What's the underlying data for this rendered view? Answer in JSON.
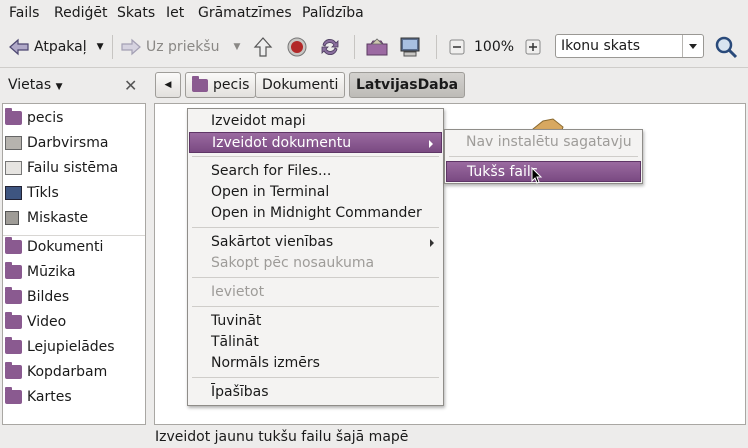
{
  "menubar": {
    "items": [
      "Fails",
      "Rediģēt",
      "Skats",
      "Iet",
      "Grāmatzīmes",
      "Palīdzība"
    ]
  },
  "toolbar": {
    "back_label": "Atpakaļ",
    "forward_label": "Uz priekšu",
    "zoom": "100%",
    "view_mode": "Ikonu skats"
  },
  "sidebar": {
    "title": "Vietas",
    "items": [
      "pecis",
      "Darbvirsma",
      "Failu sistēma",
      "Tīkls",
      "Miskaste",
      "Dokumenti",
      "Mūzika",
      "Bildes",
      "Video",
      "Lejupielādes",
      "Kopdarbam",
      "Kartes"
    ]
  },
  "pathbar": {
    "crumbs": [
      "pecis",
      "Dokumenti",
      "LatvijasDaba"
    ]
  },
  "context_menu": {
    "create_folder": "Izveidot mapi",
    "create_document": "Izveidot dokumentu",
    "search_files": "Search for Files...",
    "open_terminal": "Open in Terminal",
    "open_mc": "Open in Midnight Commander",
    "arrange_items": "Sakārtot vienības",
    "sort_by_name": "Sakopt pēc nosaukuma",
    "paste": "Ievietot",
    "zoom_in": "Tuvināt",
    "zoom_out": "Tālināt",
    "normal_size": "Normāls izmērs",
    "properties": "Īpašības"
  },
  "submenu": {
    "no_templates": "Nav instalētu sagatavju",
    "empty_file": "Tukšs fails"
  },
  "status": "Izveidot jaunu tukšu failu šajā mapē",
  "colors": {
    "highlight": "#7a4a82",
    "folder": "#8a5a90"
  }
}
